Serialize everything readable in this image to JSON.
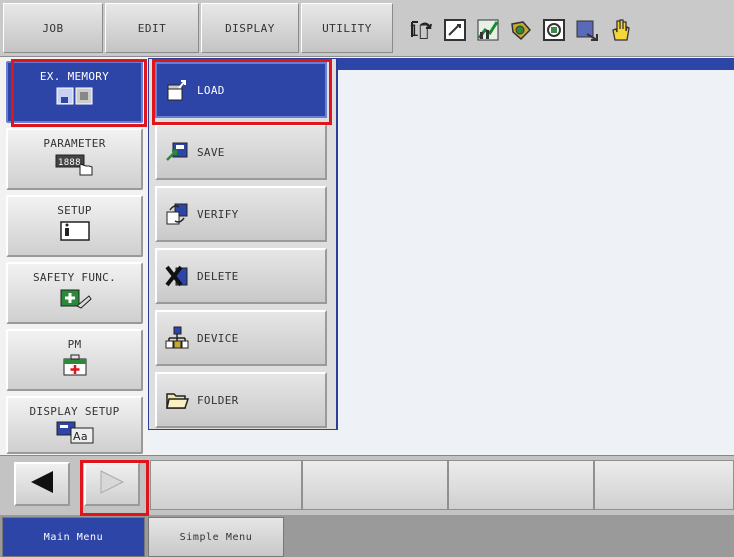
{
  "top_tabs": [
    {
      "label": "JOB"
    },
    {
      "label": "EDIT"
    },
    {
      "label": "DISPLAY"
    },
    {
      "label": "UTILITY"
    }
  ],
  "toolbar_icons": [
    "coordinate-icon",
    "edit-icon",
    "chart-icon",
    "tool-icon",
    "monitor-icon",
    "output-icon",
    "hand-icon"
  ],
  "main_menu": {
    "items": [
      {
        "label": "EX. MEMORY",
        "icon": "memory-icon",
        "active": true
      },
      {
        "label": "PARAMETER",
        "icon": "parameter-icon"
      },
      {
        "label": "SETUP",
        "icon": "setup-icon"
      },
      {
        "label": "SAFETY FUNC.",
        "icon": "safety-icon"
      },
      {
        "label": "PM",
        "icon": "pm-icon"
      },
      {
        "label": "DISPLAY SETUP",
        "icon": "display-setup-icon"
      }
    ]
  },
  "submenu": {
    "items": [
      {
        "label": "LOAD",
        "icon": "load-icon",
        "active": true
      },
      {
        "label": "SAVE",
        "icon": "save-icon"
      },
      {
        "label": "VERIFY",
        "icon": "verify-icon"
      },
      {
        "label": "DELETE",
        "icon": "delete-icon"
      },
      {
        "label": "DEVICE",
        "icon": "device-icon"
      },
      {
        "label": "FOLDER",
        "icon": "folder-icon"
      }
    ]
  },
  "bottom_tabs": [
    {
      "label": "Main Menu",
      "active": true
    },
    {
      "label": "Simple Menu"
    }
  ],
  "colors": {
    "accent": "#2e45a8",
    "highlight": "#e0151c"
  }
}
